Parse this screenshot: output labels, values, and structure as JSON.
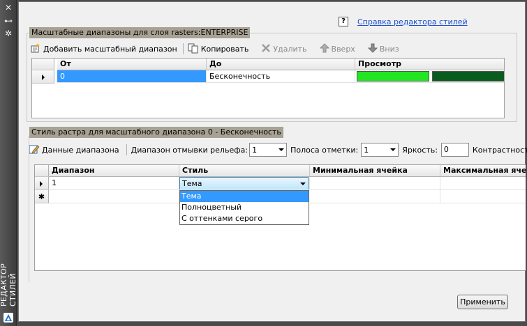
{
  "palette": {
    "title": "РЕДАКТОР СТИЛЕЙ"
  },
  "help": {
    "link": "Справка редактора стилей"
  },
  "scale_group": {
    "title": "Масштабные диапазоны для слоя rasters:ENTERPRISE",
    "toolbar": {
      "add": "Добавить масштабный диапазон",
      "copy": "Копировать",
      "delete": "Удалить",
      "up": "Вверх",
      "down": "Вниз"
    },
    "columns": [
      "От",
      "До",
      "Просмотр"
    ],
    "rows": [
      {
        "from": "0",
        "to": "Бесконечность",
        "preview_colors": [
          "#22e622",
          "#0a5c1e"
        ]
      }
    ]
  },
  "raster_group": {
    "title": "Стиль растра для масштабного диапазона 0 - Бесконечность",
    "toolbar": {
      "range_data": "Данные диапазона",
      "relief_label": "Диапазон отмывки рельефа:",
      "relief_value": "1",
      "band_label": "Полоса отметки:",
      "band_value": "1",
      "brightness_label": "Яркость:",
      "brightness_value": "0",
      "contrast_label": "Контрастность:"
    },
    "columns": [
      "Диапазон",
      "Стиль",
      "Минимальная ячейка",
      "Максимальная яче"
    ],
    "rows": [
      {
        "range": "1",
        "style": "Тема"
      }
    ],
    "new_row_marker": "✱",
    "style_options": [
      "Тема",
      "Полноцветный",
      "С оттенками серого"
    ],
    "style_selected": "Тема"
  },
  "apply_label": "Применить"
}
